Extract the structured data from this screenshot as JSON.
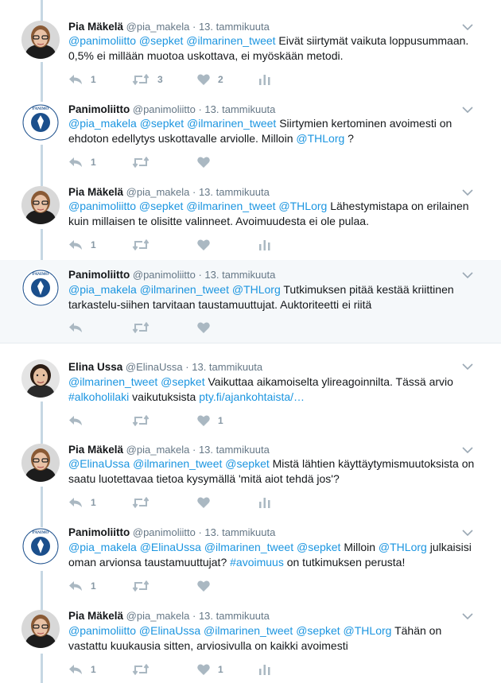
{
  "colors": {
    "link": "#1b95e0",
    "thread_line": "#c6d7e3",
    "muted": "#8899a6",
    "highlight_bg": "#f5f8fa"
  },
  "icons": {
    "reply": "reply-icon",
    "retweet": "retweet-icon",
    "like": "heart-icon",
    "analytics": "analytics-icon",
    "menu": "chevron-down-icon"
  },
  "tweets": [
    {
      "name": "Pia Mäkelä",
      "handle": "@pia_makela",
      "dot": "·",
      "date": "13. tammikuuta",
      "text_mentions": "@panimoliitto @sepket @ilmarinen_tweet",
      "text_body": "Eivät siirtymät vaikuta loppusummaan. 0,5% ei millään muotoa uskottava, ei myöskään metodi.",
      "replies": "1",
      "retweets": "3",
      "likes": "2"
    },
    {
      "name": "Panimoliitto",
      "handle": "@panimoliitto",
      "dot": "·",
      "date": "13. tammikuuta",
      "text_mentions": "@pia_makela @sepket @ilmarinen_tweet",
      "text_body": "Siirtymien kertominen avoimesti on ehdoton edellytys uskottavalle arviolle. Milloin",
      "text_mention2": "@THLorg",
      "text_tail": "?",
      "replies": "1"
    },
    {
      "name": "Pia Mäkelä",
      "handle": "@pia_makela",
      "dot": "·",
      "date": "13. tammikuuta",
      "text_mentions": "@panimoliitto @sepket @ilmarinen_tweet @THLorg",
      "text_body": "Lähestymistapa on erilainen kuin millaisen te olisitte valinneet. Avoimuudesta ei ole pulaa.",
      "replies": "1"
    },
    {
      "name": "Panimoliitto",
      "handle": "@panimoliitto",
      "dot": "·",
      "date": "13. tammikuuta",
      "text_mentions": "@pia_makela @ilmarinen_tweet @THLorg",
      "text_body": "Tutkimuksen pitää kestää kriittinen tarkastelu-siihen tarvitaan taustamuuttujat. Auktoriteetti ei riitä"
    },
    {
      "name": "Elina Ussa",
      "handle": "@ElinaUssa",
      "dot": "·",
      "date": "13. tammikuuta",
      "text_mentions": "@ilmarinen_tweet @sepket",
      "text_body": "Vaikuttaa aikamoiselta ylireagoinnilta. Tässä arvio",
      "text_hashtag": "#alkoholilaki",
      "text_mid": "vaikutuksista",
      "text_link": "pty.fi/ajankohtaista/…",
      "likes": "1"
    },
    {
      "name": "Pia Mäkelä",
      "handle": "@pia_makela",
      "dot": "·",
      "date": "13. tammikuuta",
      "text_mentions": "@ElinaUssa @ilmarinen_tweet @sepket",
      "text_body": "Mistä lähtien käyttäytymismuutoksista on saatu luotettavaa tietoa kysymällä 'mitä aiot tehdä jos'?",
      "replies": "1"
    },
    {
      "name": "Panimoliitto",
      "handle": "@panimoliitto",
      "dot": "·",
      "date": "13. tammikuuta",
      "text_mentions": "@pia_makela @ElinaUssa @ilmarinen_tweet @sepket",
      "text_body": "Milloin",
      "text_mention2": "@THLorg",
      "text_mid": "julkaisisi oman arvionsa taustamuuttujat?",
      "text_hashtag": "#avoimuus",
      "text_tail": "on tutkimuksen perusta!",
      "replies": "1"
    },
    {
      "name": "Pia Mäkelä",
      "handle": "@pia_makela",
      "dot": "·",
      "date": "13. tammikuuta",
      "text_mentions": "@panimoliitto @ElinaUssa @ilmarinen_tweet @sepket @THLorg",
      "text_body": "Tähän on vastattu kuukausia sitten, arviosivulla on kaikki avoimesti",
      "replies": "1",
      "likes": "1"
    }
  ]
}
